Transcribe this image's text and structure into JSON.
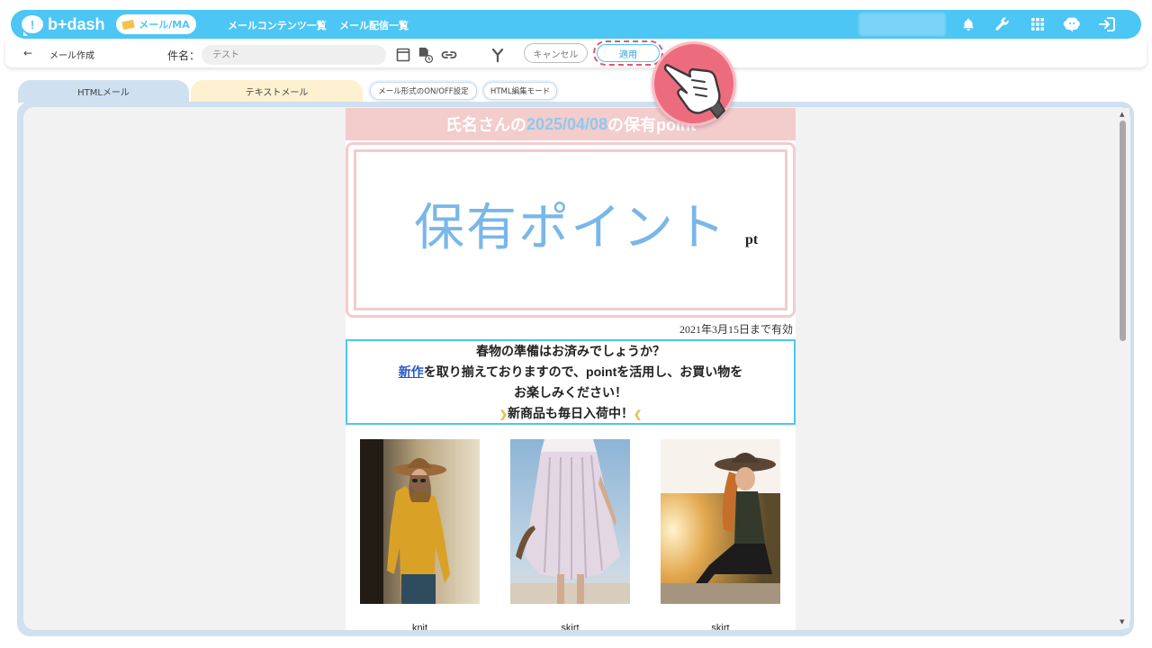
{
  "app": {
    "logo_text": "b+dash"
  },
  "topnav": {
    "active_label": "メール/MA",
    "links": [
      "メールコンテンツ一覧",
      "メール配信一覧"
    ],
    "icons": [
      "bell-icon",
      "wrench-icon",
      "grid-icon",
      "brain-icon",
      "logout-icon"
    ]
  },
  "toolbar": {
    "page_label": "メール作成",
    "subject_label": "件名：",
    "subject_value": "テスト",
    "cancel_label": "キャンセル",
    "apply_label": "適用"
  },
  "tabs": {
    "html": "HTMLメール",
    "text": "テキストメール",
    "format_toggle": "メール形式のON/OFF設定",
    "html_mode": "HTML編集モード"
  },
  "email": {
    "header_name": "氏名さんの",
    "header_date": "2025/04/08",
    "header_suffix": "の保有point",
    "point_label": "保有ポイント",
    "point_unit": "pt",
    "valid_until": "2021年3月15日まで有効",
    "message": {
      "line1": "春物の準備はお済みでしょうか？",
      "line2_link": "新作",
      "line2_rest": "を取り揃えておりますので、pointを活用し、お買い物を",
      "line3": "お楽しみください！",
      "line4": "新商品も毎日入荷中！"
    },
    "products": [
      {
        "label": "knit"
      },
      {
        "label": "skirt"
      },
      {
        "label": "skirt"
      }
    ]
  },
  "colors": {
    "brand": "#4cc6f4",
    "header_pink": "#f3cccc",
    "point_blue": "#79b7e9",
    "highlight_red": "#e25874"
  }
}
